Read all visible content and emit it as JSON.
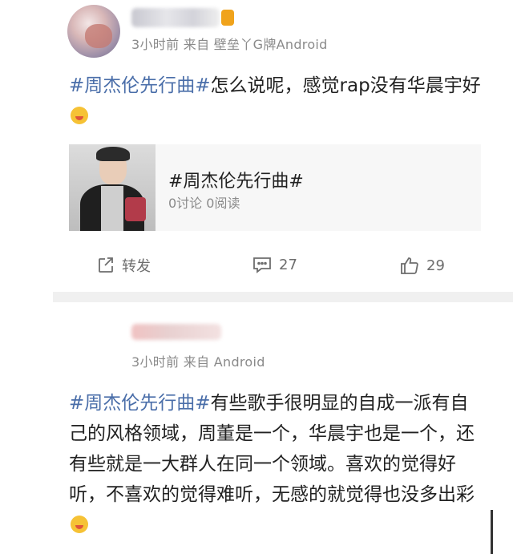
{
  "post1": {
    "meta": "3小时前 来自 壁垒丫G牌Android",
    "topic": "#周杰伦先行曲#",
    "text": "怎么说呢，感觉rap没有华晨宇好",
    "card": {
      "title": "#周杰伦先行曲#",
      "stats": "0讨论 0阅读"
    },
    "actions": {
      "share_label": "转发",
      "comment_count": "27",
      "like_count": "29"
    }
  },
  "post2": {
    "meta": "3小时前 来自 Android",
    "topic": "#周杰伦先行曲#",
    "text": "有些歌手很明显的自成一派有自己的风格领域，周董是一个，华晨宇也是一个，还有些就是一大群人在同一个领域。喜欢的觉得好听，不喜欢的觉得难听，无感的就觉得也没多出彩"
  },
  "icons": {
    "share": "share-icon",
    "comment": "comment-icon",
    "like": "thumbs-up-icon",
    "emoji1": "tongue-emoji-icon",
    "emoji2": "laughing-emoji-icon"
  },
  "colors": {
    "topic": "#4a6ea9",
    "meta": "#8a8a8a",
    "separator": "#f0f0f0"
  }
}
